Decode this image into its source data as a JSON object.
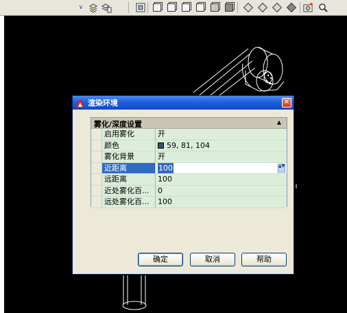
{
  "toolbar": {
    "icons": [
      "dropdown-arrow-icon",
      "layer-icon",
      "layer-properties-icon",
      "view-icon",
      "top-view-icon",
      "bottom-view-icon",
      "left-view-icon",
      "right-view-icon",
      "front-view-icon",
      "back-view-icon",
      "sw-iso-icon",
      "se-iso-icon",
      "ne-iso-icon",
      "nw-iso-icon",
      "camera-icon",
      "zoom-icon"
    ]
  },
  "dialog": {
    "title": "渲染环境",
    "close_label": "✕",
    "section_title": "雾化/深度设置",
    "collapse_glyph": "▲",
    "rows": [
      {
        "name": "启用雾化",
        "value": "开"
      },
      {
        "name": "颜色",
        "value": "59, 81, 104",
        "swatch_color": "#3b5168"
      },
      {
        "name": "雾化背景",
        "value": "开"
      },
      {
        "name": "近距离",
        "value": "100"
      },
      {
        "name": "远距离",
        "value": "100"
      },
      {
        "name": "近处雾化百...",
        "value": "0"
      },
      {
        "name": "远处雾化百...",
        "value": "100"
      }
    ],
    "selected_row": 3,
    "spinner_glyph": "▲▼",
    "buttons": {
      "ok": "确定",
      "cancel": "取消",
      "help": "帮助"
    }
  },
  "colors": {
    "viewport_bg": "#000000",
    "titlebar": "#1f5fd8",
    "property_row_bg": "#dceddc",
    "selection": "#316ac5"
  }
}
